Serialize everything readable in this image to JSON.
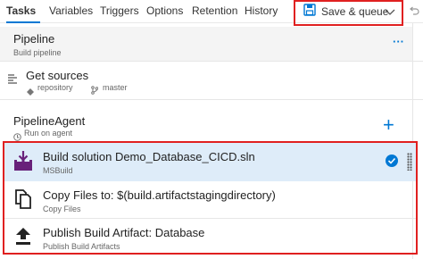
{
  "toolbar": {
    "tabs": [
      {
        "label": "Tasks",
        "active": true
      },
      {
        "label": "Variables"
      },
      {
        "label": "Triggers"
      },
      {
        "label": "Options"
      },
      {
        "label": "Retention"
      },
      {
        "label": "History"
      }
    ],
    "save_label": "Save & queue",
    "save_icon": "save-icon",
    "dropdown_icon": "chevron-down-icon",
    "undo_icon": "undo-icon"
  },
  "pipeline": {
    "title": "Pipeline",
    "subtitle": "Build pipeline",
    "more_icon": "ellipsis-icon"
  },
  "get_sources": {
    "title": "Get sources",
    "repository": "repository",
    "branch": "master"
  },
  "agent": {
    "title": "PipelineAgent",
    "subtitle": "Run on agent",
    "add_icon": "plus-icon"
  },
  "tasks": [
    {
      "title": "Build solution Demo_Database_CICD.sln",
      "subtitle": "MSBuild",
      "icon": "msbuild-icon",
      "selected": true
    },
    {
      "title": "Copy Files to: $(build.artifactstagingdirectory)",
      "subtitle": "Copy Files",
      "icon": "copy-files-icon"
    },
    {
      "title": "Publish Build Artifact: Database",
      "subtitle": "Publish Build Artifacts",
      "icon": "upload-icon"
    }
  ],
  "colors": {
    "accent": "#0078d4",
    "highlight_border": "#e02020",
    "selected_row": "#deecf9",
    "msbuild_purple": "#68217a"
  }
}
